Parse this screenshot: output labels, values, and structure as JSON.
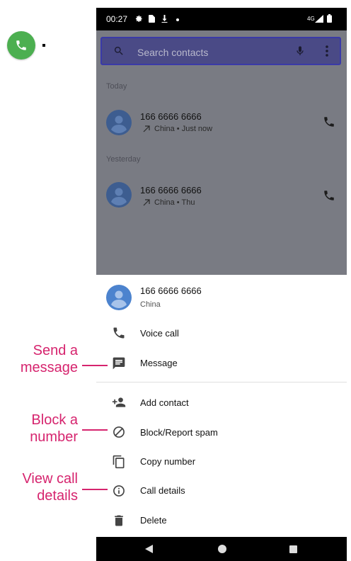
{
  "status_bar": {
    "time": "00:27",
    "network": "4G"
  },
  "search": {
    "placeholder": "Search contacts"
  },
  "call_log": {
    "sections": [
      {
        "label": "Today",
        "number": "166 6666 6666",
        "detail": "China • Just now"
      },
      {
        "label": "Yesterday",
        "number": "166 6666 6666",
        "detail": "China • Thu"
      }
    ]
  },
  "sheet": {
    "contact_number": "166 6666 6666",
    "contact_location": "China",
    "items": [
      {
        "label": "Voice call",
        "icon": "phone-icon"
      },
      {
        "label": "Message",
        "icon": "message-icon"
      },
      {
        "label": "Add contact",
        "icon": "add-person-icon"
      },
      {
        "label": "Block/Report spam",
        "icon": "block-icon"
      },
      {
        "label": "Copy number",
        "icon": "copy-icon"
      },
      {
        "label": "Call details",
        "icon": "info-icon"
      },
      {
        "label": "Delete",
        "icon": "trash-icon"
      }
    ]
  },
  "callouts": {
    "message": [
      "Send a",
      "message"
    ],
    "block": [
      "Block a",
      "number"
    ],
    "details": [
      "View call",
      "details"
    ]
  },
  "colors": {
    "accent": "#d6246e",
    "app_green": "#4caf50",
    "avatar_blue": "#4c83ce",
    "scrim": "#797b83"
  }
}
